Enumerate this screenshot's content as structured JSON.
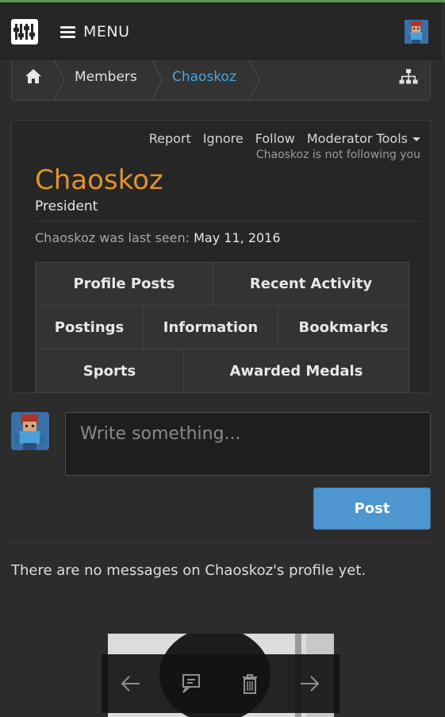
{
  "navbar": {
    "menu_label": "MENU",
    "icons": [
      "app-logo",
      "hamburger-icon",
      "user-avatar"
    ]
  },
  "breadcrumb": {
    "items": [
      {
        "label": "Members",
        "current": false
      },
      {
        "label": "Chaoskoz",
        "current": true
      }
    ],
    "icons": [
      "home-icon",
      "sitemap-icon"
    ]
  },
  "profile": {
    "actions": {
      "report": "Report",
      "ignore": "Ignore",
      "follow": "Follow",
      "moderator_tools": "Moderator Tools"
    },
    "follow_status": "Chaoskoz is not following you",
    "username": "Chaoskoz",
    "user_title": "President",
    "last_seen_label": "Chaoskoz was last seen:",
    "last_seen_value": "May 11, 2016",
    "tabs": {
      "profile_posts": "Profile Posts",
      "recent_activity": "Recent Activity",
      "postings": "Postings",
      "information": "Information",
      "bookmarks": "Bookmarks",
      "sports": "Sports",
      "awarded_medals": "Awarded Medals"
    }
  },
  "compose": {
    "placeholder": "Write something...",
    "post_label": "Post"
  },
  "messages": {
    "empty_text": "There are no messages on Chaoskoz's profile yet."
  },
  "overlay_toolbar": {
    "icons": [
      "arrow-left-icon",
      "comment-icon",
      "trash-icon",
      "arrow-right-icon"
    ]
  },
  "colors": {
    "username": "#e2922e",
    "link": "#4fa3e0",
    "post_button": "#4d96d0",
    "page_bg": "#2c2c2c"
  }
}
